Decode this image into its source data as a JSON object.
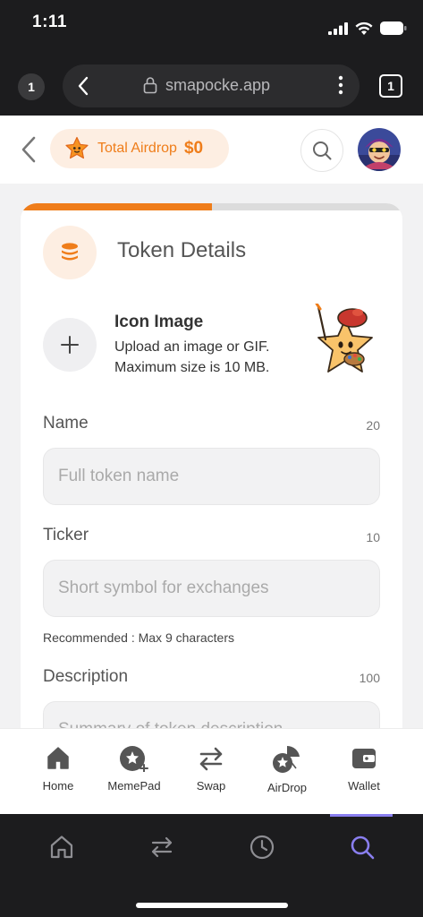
{
  "status_bar": {
    "time": "1:11"
  },
  "browser": {
    "tab_count_left": "1",
    "url": "smapocke.app",
    "tab_count": "1"
  },
  "header": {
    "airdrop_label": "Total Airdrop",
    "airdrop_value": "$0"
  },
  "form": {
    "progress": 0.5,
    "section_title": "Token Details",
    "icon_image": {
      "title": "Icon Image",
      "description_line1": "Upload an image or GIF.",
      "description_line2": "Maximum size is 10 MB."
    },
    "name": {
      "label": "Name",
      "max": "20",
      "placeholder": "Full token name"
    },
    "ticker": {
      "label": "Ticker",
      "max": "10",
      "placeholder": "Short symbol for exchanges",
      "hint": "Recommended : Max 9 characters"
    },
    "description": {
      "label": "Description",
      "max": "100",
      "placeholder": "Summary of token description"
    }
  },
  "nav": {
    "items": [
      {
        "label": "Home",
        "icon": "home-icon"
      },
      {
        "label": "MemePad",
        "icon": "memepad-icon"
      },
      {
        "label": "Swap",
        "icon": "swap-icon"
      },
      {
        "label": "AirDrop",
        "icon": "airdrop-icon"
      },
      {
        "label": "Wallet",
        "icon": "wallet-icon"
      }
    ]
  },
  "colors": {
    "accent": "#ef7d1a",
    "accent_soft": "#fdeee2",
    "system_active": "#8a7ff0"
  }
}
